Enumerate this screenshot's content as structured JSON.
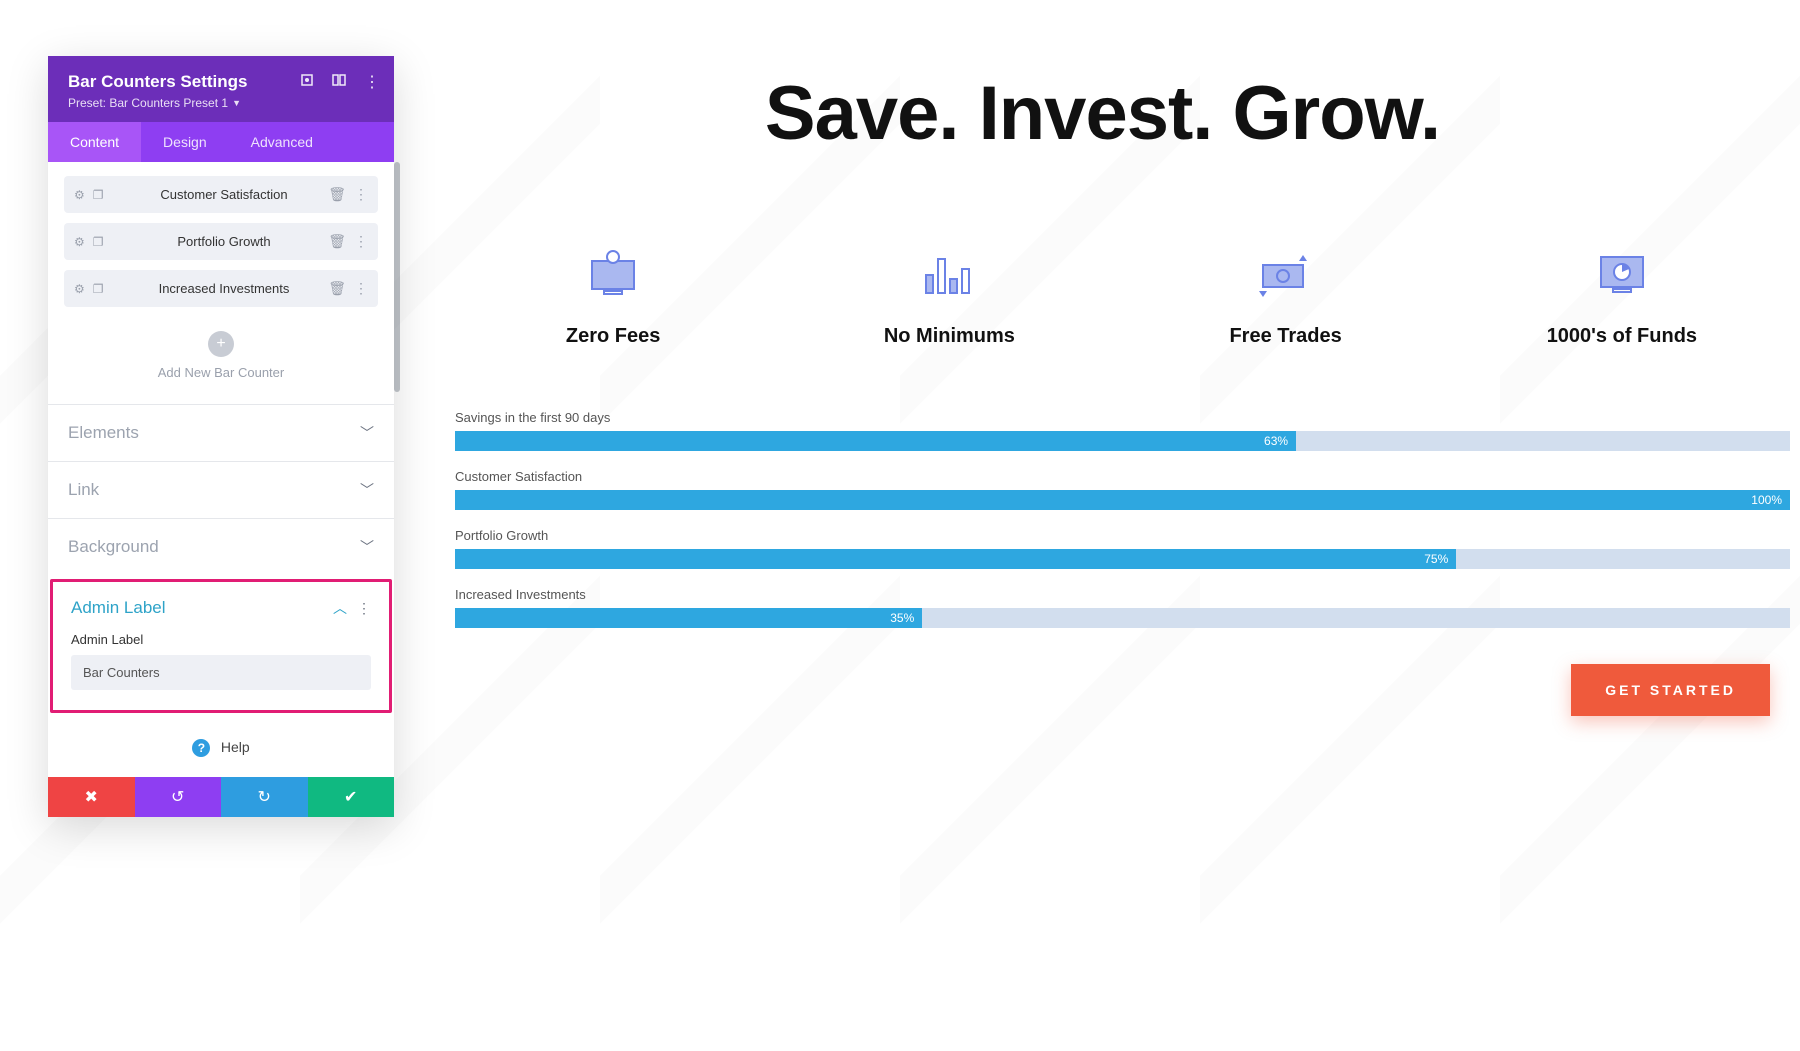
{
  "panel": {
    "title": "Bar Counters Settings",
    "preset": "Preset: Bar Counters Preset 1",
    "tabs": {
      "content": "Content",
      "design": "Design",
      "advanced": "Advanced"
    },
    "items": [
      {
        "label": "Customer Satisfaction"
      },
      {
        "label": "Portfolio Growth"
      },
      {
        "label": "Increased Investments"
      }
    ],
    "add_label": "Add New Bar Counter",
    "accordions": {
      "elements": "Elements",
      "link": "Link",
      "background": "Background",
      "admin": "Admin Label"
    },
    "admin_field_label": "Admin Label",
    "admin_input_value": "Bar Counters",
    "help": "Help"
  },
  "hero": {
    "title": "Save. Invest. Grow."
  },
  "features": [
    {
      "label": "Zero Fees"
    },
    {
      "label": "No Minimums"
    },
    {
      "label": "Free Trades"
    },
    {
      "label": "1000's of Funds"
    }
  ],
  "bars": [
    {
      "title": "Savings in the first 90 days",
      "pct": 63,
      "pct_label": "63%"
    },
    {
      "title": "Customer Satisfaction",
      "pct": 100,
      "pct_label": "100%"
    },
    {
      "title": "Portfolio Growth",
      "pct": 75,
      "pct_label": "75%"
    },
    {
      "title": "Increased Investments",
      "pct": 35,
      "pct_label": "35%"
    }
  ],
  "cta": {
    "label": "GET STARTED"
  },
  "chart_data": {
    "type": "bar",
    "categories": [
      "Savings in the first 90 days",
      "Customer Satisfaction",
      "Portfolio Growth",
      "Increased Investments"
    ],
    "values": [
      63,
      100,
      75,
      35
    ],
    "title": "",
    "xlabel": "",
    "ylabel": "",
    "ylim": [
      0,
      100
    ]
  }
}
